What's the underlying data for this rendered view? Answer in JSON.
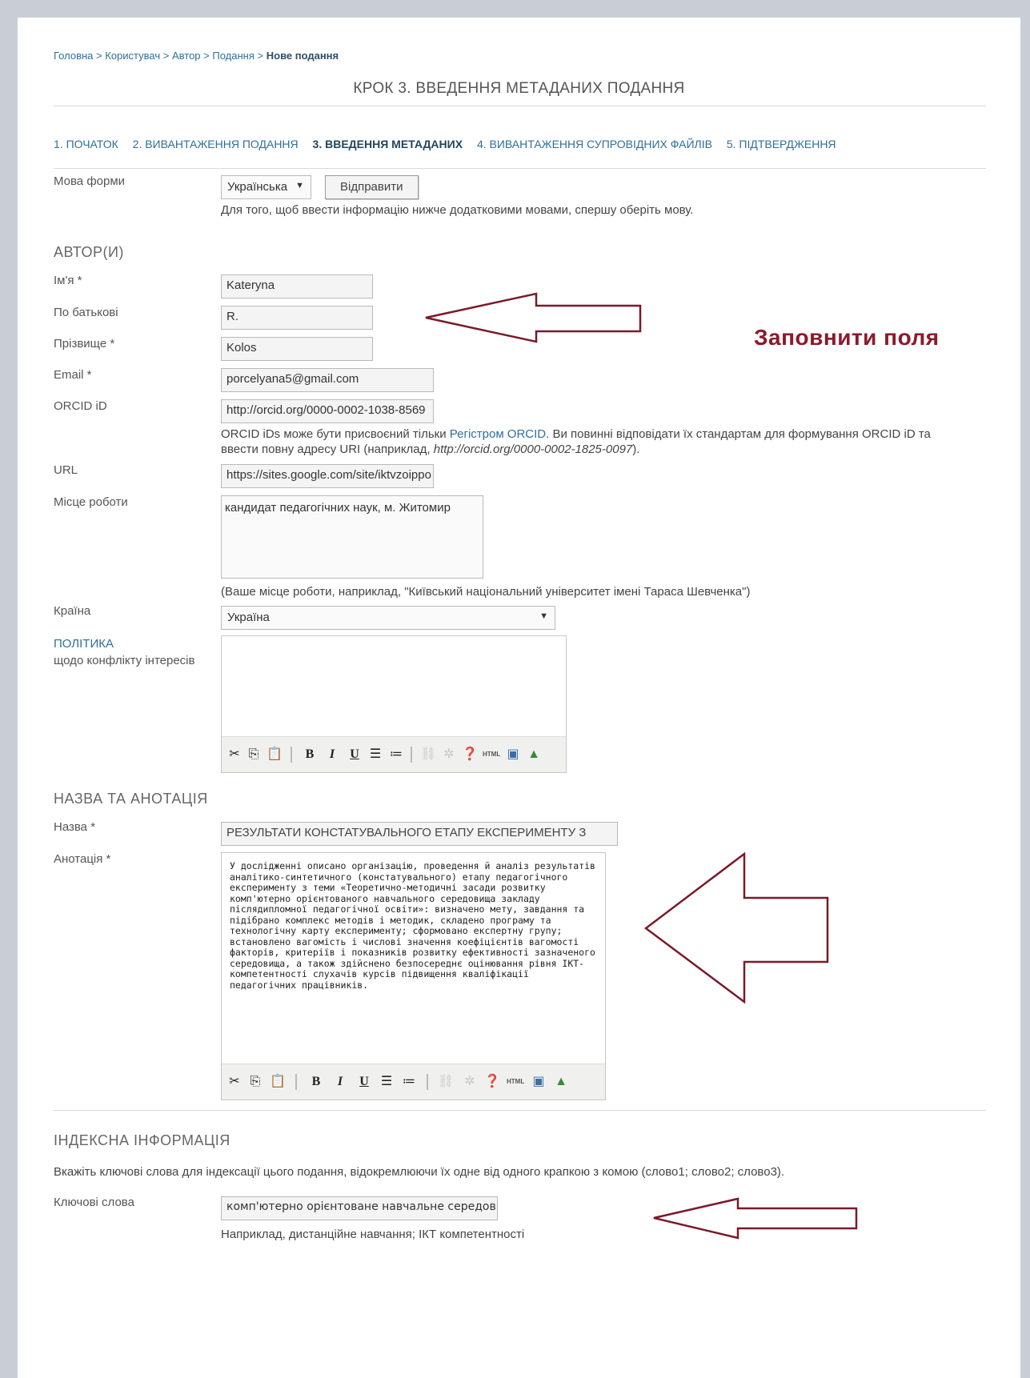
{
  "breadcrumb": {
    "items": [
      "Головна",
      "Користувач",
      "Автор",
      "Подання"
    ],
    "current": "Нове подання",
    "separator": ">"
  },
  "page_title": "КРОК 3. ВВЕДЕННЯ МЕТАДАНИХ ПОДАННЯ",
  "steps": [
    {
      "label": "1. ПОЧАТОК"
    },
    {
      "label": "2. ВИВАНТАЖЕННЯ ПОДАННЯ"
    },
    {
      "label": "3. ВВЕДЕННЯ МЕТАДАНИХ"
    },
    {
      "label": "4. ВИВАНТАЖЕННЯ СУПРОВІДНИХ ФАЙЛІВ"
    },
    {
      "label": "5. ПІДТВЕРДЖЕННЯ"
    }
  ],
  "form_language": {
    "label": "Мова форми",
    "selected": "Українська",
    "submit_label": "Відправити",
    "help": "Для того, щоб ввести інформацію нижче додатковими мовами, спершу оберіть мову."
  },
  "authors": {
    "heading": "АВТОР(И)",
    "first_name": {
      "label": "Ім'я *",
      "value": "Kateryna"
    },
    "middle_name": {
      "label": "По батькові",
      "value": "R."
    },
    "last_name": {
      "label": "Прізвище *",
      "value": "Kolos"
    },
    "email": {
      "label": "Email *",
      "value": "porcelyana5@gmail.com"
    },
    "orcid": {
      "label": "ORCID iD",
      "value": "http://orcid.org/0000-0002-1038-8569",
      "help_pre": "ORCID iDs може бути присвоєний тільки ",
      "help_link": "Регістром ORCID",
      "help_mid": ". Ви повинні відповідати їх стандартам для формування ORCID iD та ввести повну адресу URI (наприклад, ",
      "help_example": "http://orcid.org/0000-0002-1825-0097",
      "help_post": ")."
    },
    "url": {
      "label": "URL",
      "value": "https://sites.google.com/site/iktvzoippo"
    },
    "affiliation": {
      "label": "Місце роботи",
      "value": "кандидат педагогічних наук, м. Житомир",
      "help": "(Ваше місце роботи, наприклад, \"Київський національний університет імені Тараса Шевченка\")"
    },
    "country": {
      "label": "Країна",
      "selected": "Україна"
    },
    "competing_interests": {
      "label_link": "ПОЛІТИКА",
      "label": "щодо конфлікту інтересів"
    }
  },
  "annotation_text": "Заповнити поля",
  "title_abstract": {
    "heading": "НАЗВА ТА АНОТАЦІЯ",
    "title": {
      "label": "Назва *",
      "value": "РЕЗУЛЬТАТИ КОНСТАТУВАЛЬНОГО ЕТАПУ ЕКСПЕРИМЕНТУ З"
    },
    "abstract": {
      "label": "Анотація *",
      "value": "У дослідженні описано організацію, проведення й аналіз результатів аналітико-синтетичного (констатувального) етапу педагогічного експерименту з теми «Теоретично-методичні засади розвитку комп'ютерно орієнтованого навчального середовища закладу післядипломної педагогічної освіти»: визначено мету, завдання та підібрано комплекс методів і методик, складено програму та технологічну карту експерименту; сформовано експертну групу; встановлено вагомість і числові значення коефіцієнтів вагомості факторів, критеріїв і показників розвитку ефективності зазначеного середовища, а також здійснено безпосереднє оцінювання рівня ІКТ-компетентності слухачів курсів підвищення кваліфікації педагогічних працівників."
    }
  },
  "indexing": {
    "heading": "ІНДЕКСНА ІНФОРМАЦІЯ",
    "description": "Вкажіть ключові слова для індексації цього подання, відокремлюючи їх одне від одного крапкою з комою (слово1; слово2; слово3).",
    "keywords": {
      "label": "Ключові слова",
      "value": "комп'ютерно орієнтоване навчальне середовище",
      "help": "Наприклад, дистанційне навчання; ІКТ компетентності"
    }
  },
  "toolbar": {
    "bold": "B",
    "italic": "I",
    "underline": "U",
    "html": "HTML"
  },
  "colors": {
    "accent": "#2f6f9a",
    "annotation": "#8b1a2b",
    "background": "#c9ced6"
  }
}
